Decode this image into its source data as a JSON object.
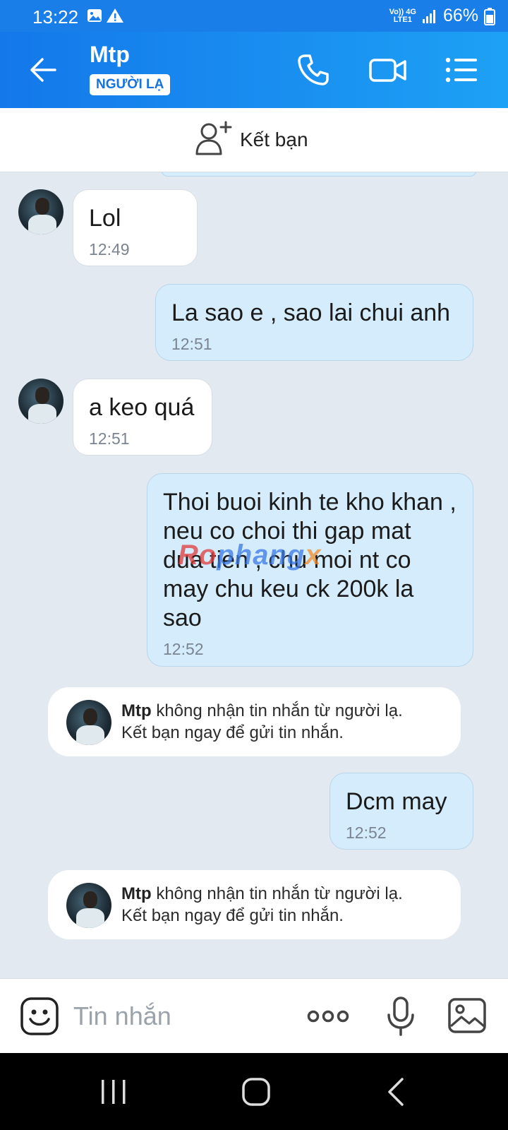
{
  "status_bar": {
    "time": "13:22",
    "network_top": "Vo)) 4G",
    "network_bottom": "LTE1",
    "battery": "66%"
  },
  "header": {
    "title": "Mtp",
    "badge": "NGƯỜI LẠ"
  },
  "add_friend": {
    "label": "Kết bạn"
  },
  "messages": [
    {
      "side": "in",
      "text": "Lol",
      "time": "12:49"
    },
    {
      "side": "out",
      "text": "La sao e , sao lai chui anh",
      "time": "12:51"
    },
    {
      "side": "in",
      "text": "a keo quá",
      "time": "12:51"
    },
    {
      "side": "out",
      "text": "Thoi buoi kinh te kho khan , neu co choi thi gap mat dua tien , chu moi nt co may chu keu ck 200k la sao",
      "time": "12:52"
    },
    {
      "side": "out",
      "text": "Dcm may",
      "time": "12:52"
    }
  ],
  "notices": [
    {
      "name": "Mtp",
      "text": " không nhận tin nhắn từ người lạ.",
      "line2": "Kết bạn ngay để gửi tin nhắn."
    },
    {
      "name": "Mtp",
      "text": " không nhận tin nhắn từ người lạ.",
      "line2": "Kết bạn ngay để gửi tin nhắn."
    }
  ],
  "watermark": {
    "part1": "Ro",
    "part2": "phang",
    "part3": "x"
  },
  "input": {
    "placeholder": "Tin nhắn"
  },
  "colors": {
    "header": "#1a7ee8",
    "outgoing_bubble": "#d4ecfb",
    "incoming_bubble": "#ffffff",
    "chat_background": "#e2e9f1",
    "accent": "#1574e0"
  },
  "icons": {
    "back": "arrow-left-icon",
    "call": "phone-icon",
    "video": "video-camera-icon",
    "menu": "list-menu-icon",
    "add_friend": "add-person-icon",
    "emoji": "emoji-icon",
    "more": "more-dots-icon",
    "mic": "microphone-icon",
    "image": "image-icon"
  }
}
